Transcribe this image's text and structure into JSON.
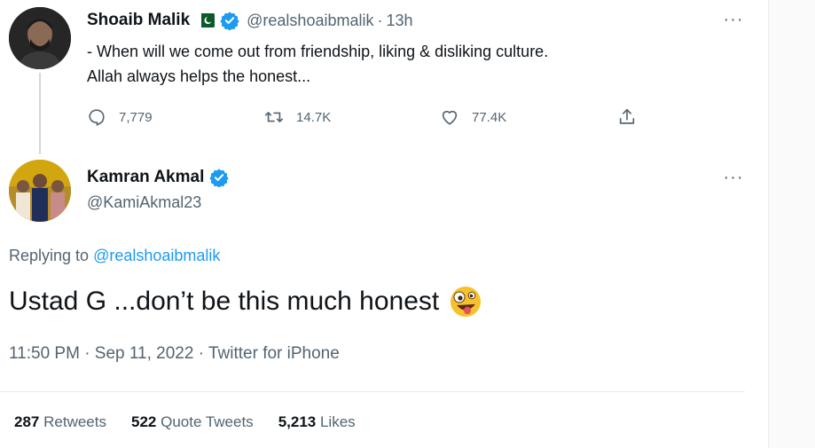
{
  "tweet": {
    "author": {
      "display_name": "Shoaib Malik",
      "handle": "@realshoaibmalik",
      "separator": "·",
      "time": "13h",
      "flag_icon": "pakistan-flag-icon",
      "verified_icon": "verified-badge-icon"
    },
    "text_line1": "- When will we come out from friendship, liking & disliking culture.",
    "text_line2": "Allah always helps the honest...",
    "actions": {
      "replies": "7,779",
      "retweets": "14.7K",
      "likes": "77.4K"
    },
    "more_label": "···"
  },
  "reply": {
    "author": {
      "display_name": "Kamran Akmal",
      "handle": "@KamiAkmal23",
      "verified_icon": "verified-badge-icon"
    },
    "replying_prefix": "Replying to",
    "replying_to": "@realshoaibmalik",
    "text": "Ustad G ...don’t be this much honest",
    "emoji": "zany-face-emoji",
    "meta": "11:50 PM · Sep 11, 2022 · Twitter for iPhone",
    "stats": {
      "retweets_count": "287",
      "retweets_label": "Retweets",
      "quotes_count": "522",
      "quotes_label": "Quote Tweets",
      "likes_count": "5,213",
      "likes_label": "Likes"
    },
    "more_label": "···"
  },
  "colors": {
    "text": "#0f1419",
    "secondary": "#536471",
    "link": "#1d9bf0",
    "divider": "#e6ecf0"
  }
}
